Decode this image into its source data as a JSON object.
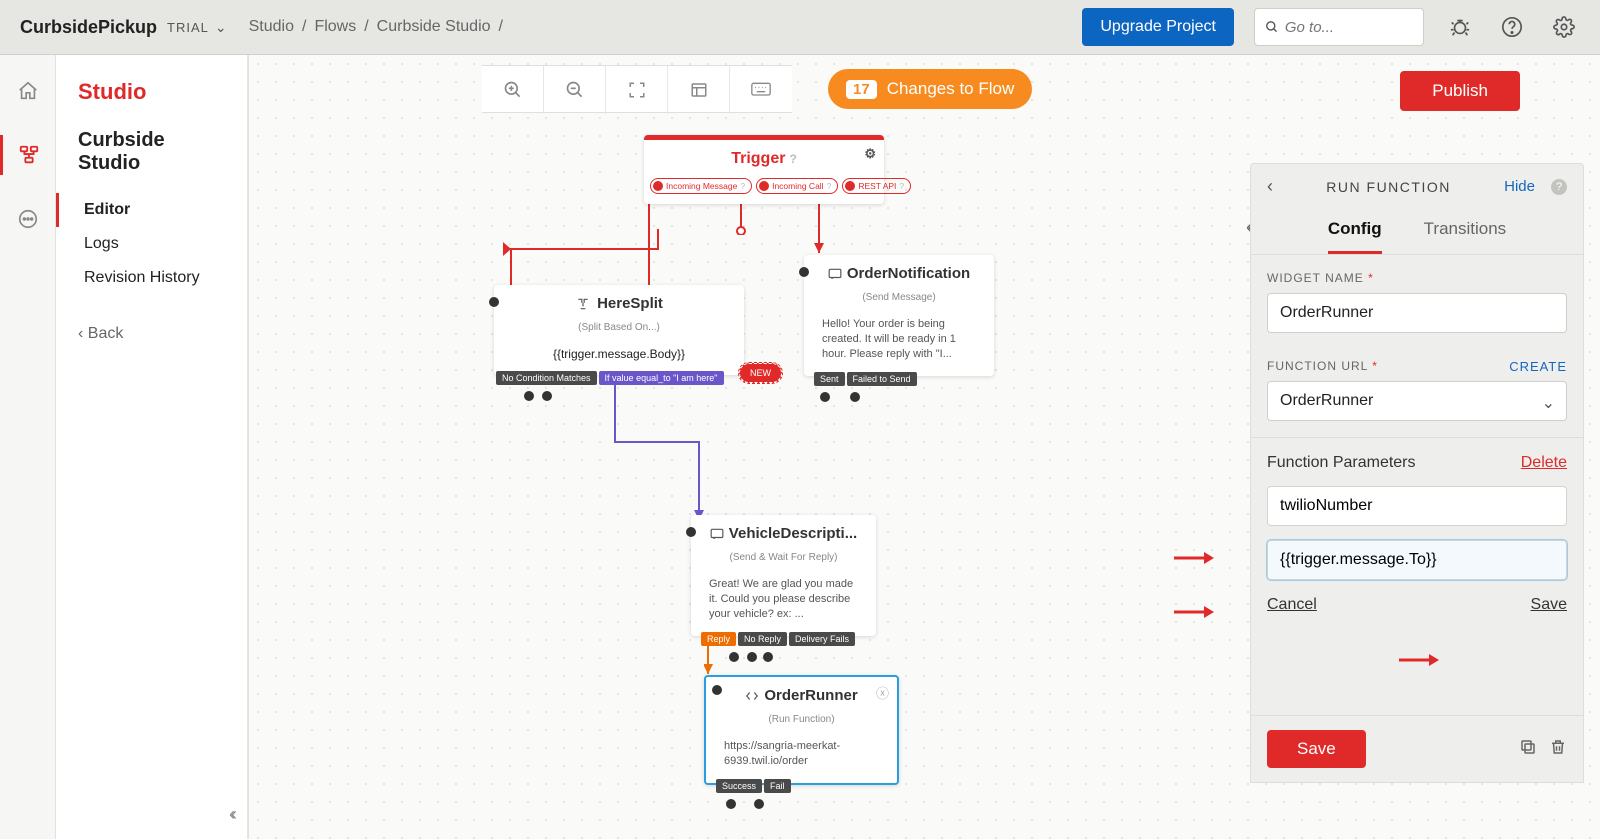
{
  "topbar": {
    "project": "CurbsidePickup",
    "plan": "TRIAL",
    "crumbs": [
      "Studio",
      "Flows",
      "Curbside Studio",
      ""
    ],
    "upgrade": "Upgrade Project",
    "search_placeholder": "Go to..."
  },
  "sidenav": {
    "title": "Studio",
    "flow": "Curbside Studio",
    "items": [
      "Editor",
      "Logs",
      "Revision History"
    ],
    "back": "‹ Back"
  },
  "toolbar": {
    "changes_count": "17",
    "changes_label": "Changes to Flow",
    "publish": "Publish"
  },
  "nodes": {
    "trigger": {
      "title": "Trigger",
      "pills": [
        "Incoming Message",
        "Incoming Call",
        "REST API"
      ]
    },
    "heresplit": {
      "title": "HereSplit",
      "sub": "(Split Based On...)",
      "body": "{{trigger.message.Body}}",
      "tags": [
        "No Condition Matches",
        "If value equal_to \"I am here\""
      ],
      "new": "NEW"
    },
    "ordern": {
      "title": "OrderNotification",
      "sub": "(Send Message)",
      "body": "Hello! Your order is being created. It will be ready in 1 hour. Please reply with \"I...",
      "tags": [
        "Sent",
        "Failed to Send"
      ]
    },
    "vehicle": {
      "title": "VehicleDescripti...",
      "sub": "(Send & Wait For Reply)",
      "body": "Great! We are glad you made it. Could you please describe your vehicle? ex: ...",
      "tags": [
        "Reply",
        "No Reply",
        "Delivery Fails"
      ]
    },
    "orderrun": {
      "title": "OrderRunner",
      "sub": "(Run Function)",
      "body": "https://sangria-meerkat-6939.twil.io/order",
      "tags": [
        "Success",
        "Fail"
      ]
    }
  },
  "panel": {
    "title": "RUN FUNCTION",
    "hide": "Hide",
    "tabs": [
      "Config",
      "Transitions"
    ],
    "widget_label": "WIDGET NAME",
    "widget_value": "OrderRunner",
    "func_label": "FUNCTION URL",
    "func_value": "OrderRunner",
    "create": "CREATE",
    "params_title": "Function Parameters",
    "delete": "Delete",
    "param_key": "twilioNumber",
    "param_val": "{{trigger.message.To}}",
    "cancel": "Cancel",
    "save_link": "Save",
    "save_btn": "Save"
  }
}
